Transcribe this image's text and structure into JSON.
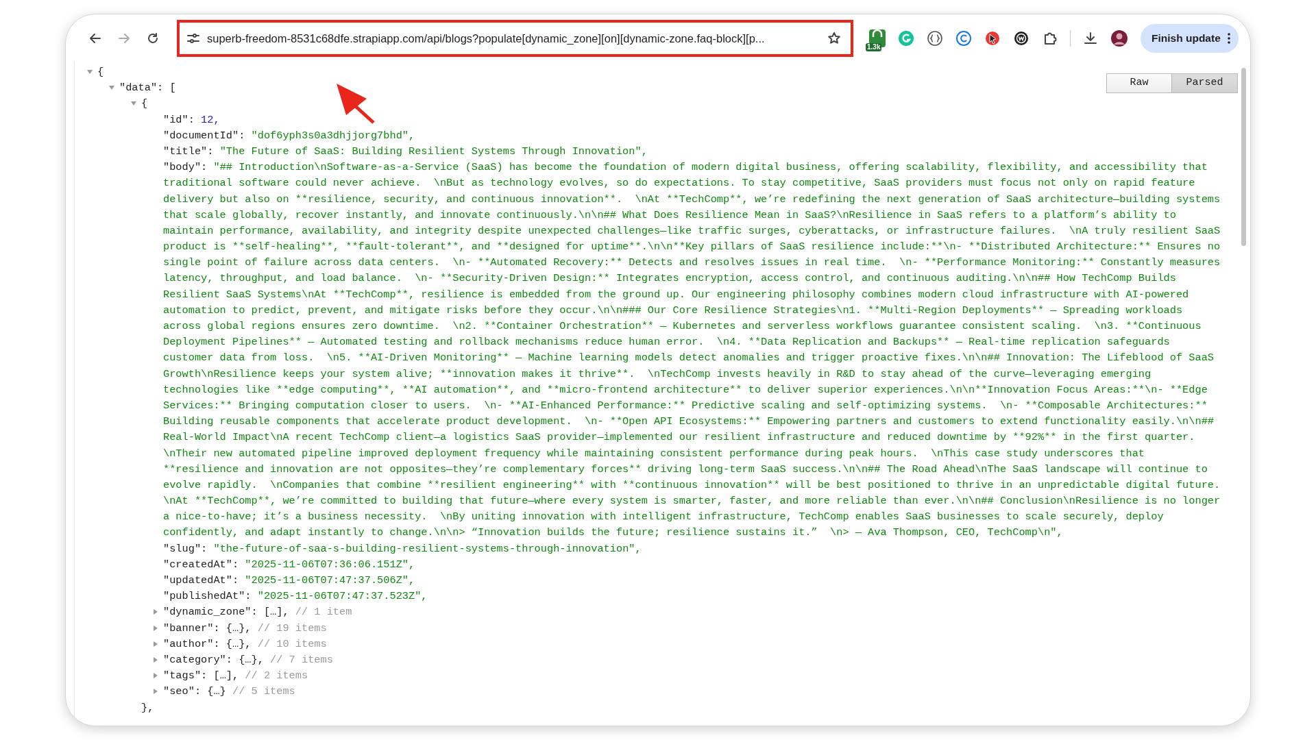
{
  "browser": {
    "url": "superb-freedom-8531c68dfe.strapiapp.com/api/blogs?populate[dynamic_zone][on][dynamic-zone.faq-block][p...",
    "extension_badge": "1.3k",
    "update_button": "Finish update"
  },
  "annotations": {
    "url_highlight": true,
    "arrow": true
  },
  "viewer_modes": [
    {
      "label": "Raw",
      "selected": false
    },
    {
      "label": "Parsed",
      "selected": true
    }
  ],
  "json_tree": {
    "open": "{",
    "expanded": true,
    "children": [
      {
        "key": "\"data\":",
        "open": "[",
        "expanded": true,
        "children": [
          {
            "open": "{",
            "expanded": true,
            "close": "},",
            "children": [
              {
                "kind": "number",
                "key": "\"id\":",
                "value": "12,"
              },
              {
                "kind": "string",
                "key": "\"documentId\":",
                "value": "\"dof6yph3s0a3dhjjorg7bhd\","
              },
              {
                "kind": "string",
                "key": "\"title\":",
                "value": "\"The Future of SaaS: Building Resilient Systems Through Innovation\","
              },
              {
                "kind": "long_string",
                "key": "\"body\":",
                "value_lines": [
                  "\"## Introduction\\nSoftware-as-a-Service (SaaS) has become the foundation of modern digital business, offering scalability, flexibility, and accessibility that",
                  "traditional software could never achieve.  \\nBut as technology evolves, so do expectations. To stay competitive, SaaS providers must focus not only on rapid feature",
                  "delivery but also on **resilience, security, and continuous innovation**.  \\nAt **TechComp**, we’re redefining the next generation of SaaS architecture—building systems",
                  "that scale globally, recover instantly, and innovate continuously.\\n\\n## What Does Resilience Mean in SaaS?\\nResilience in SaaS refers to a platform’s ability to",
                  "maintain performance, availability, and integrity despite unexpected challenges—like traffic surges, cyberattacks, or infrastructure failures.  \\nA truly resilient SaaS",
                  "product is **self-healing**, **fault-tolerant**, and **designed for uptime**.\\n\\n**Key pillars of SaaS resilience include:**\\n- **Distributed Architecture:** Ensures no",
                  "single point of failure across data centers.  \\n- **Automated Recovery:** Detects and resolves issues in real time.  \\n- **Performance Monitoring:** Constantly measures",
                  "latency, throughput, and load balance.  \\n- **Security-Driven Design:** Integrates encryption, access control, and continuous auditing.\\n\\n## How TechComp Builds",
                  "Resilient SaaS Systems\\nAt **TechComp**, resilience is embedded from the ground up. Our engineering philosophy combines modern cloud infrastructure with AI-powered",
                  "automation to predict, prevent, and mitigate risks before they occur.\\n\\n### Our Core Resilience Strategies\\n1. **Multi-Region Deployments** — Spreading workloads",
                  "across global regions ensures zero downtime.  \\n2. **Container Orchestration** — Kubernetes and serverless workflows guarantee consistent scaling.  \\n3. **Continuous",
                  "Deployment Pipelines** — Automated testing and rollback mechanisms reduce human error.  \\n4. **Data Replication and Backups** — Real-time replication safeguards",
                  "customer data from loss.  \\n5. **AI-Driven Monitoring** — Machine learning models detect anomalies and trigger proactive fixes.\\n\\n## Innovation: The Lifeblood of SaaS",
                  "Growth\\nResilience keeps your system alive; **innovation makes it thrive**.  \\nTechComp invests heavily in R&D to stay ahead of the curve—leveraging emerging",
                  "technologies like **edge computing**, **AI automation**, and **micro-frontend architecture** to deliver superior experiences.\\n\\n**Innovation Focus Areas:**\\n- **Edge",
                  "Services:** Bringing computation closer to users.  \\n- **AI-Enhanced Performance:** Predictive scaling and self-optimizing systems.  \\n- **Composable Architectures:**",
                  "Building reusable components that accelerate product development.  \\n- **Open API Ecosystems:** Empowering partners and customers to extend functionality easily.\\n\\n##",
                  "Real-World Impact\\nA recent TechComp client—a logistics SaaS provider—implemented our resilient infrastructure and reduced downtime by **92%** in the first quarter.",
                  "\\nTheir new automated pipeline improved deployment frequency while maintaining consistent performance during peak hours.  \\nThis case study underscores that",
                  "**resilience and innovation are not opposites—they’re complementary forces** driving long-term SaaS success.\\n\\n## The Road Ahead\\nThe SaaS landscape will continue to",
                  "evolve rapidly.  \\nCompanies that combine **resilient engineering** with **continuous innovation** will be best positioned to thrive in an unpredictable digital future.",
                  "\\nAt **TechComp**, we’re committed to building that future—where every system is smarter, faster, and more reliable than ever.\\n\\n## Conclusion\\nResilience is no longer",
                  "a nice-to-have; it’s a business necessity.  \\nBy uniting innovation with intelligent infrastructure, TechComp enables SaaS businesses to scale securely, deploy",
                  "confidently, and adapt instantly to change.\\n\\n> “Innovation builds the future; resilience sustains it.”  \\n> — Ava Thompson, CEO, TechComp\\n\","
                ]
              },
              {
                "kind": "string",
                "key": "\"slug\":",
                "value": "\"the-future-of-saa-s-building-resilient-systems-through-innovation\","
              },
              {
                "kind": "string",
                "key": "\"createdAt\":",
                "value": "\"2025-11-06T07:36:06.151Z\","
              },
              {
                "kind": "string",
                "key": "\"updatedAt\":",
                "value": "\"2025-11-06T07:47:37.506Z\","
              },
              {
                "kind": "string",
                "key": "\"publishedAt\":",
                "value": "\"2025-11-06T07:47:37.523Z\","
              },
              {
                "kind": "collapsed",
                "expanded": false,
                "key": "\"dynamic_zone\":",
                "value": "[…],",
                "comment": "// 1 item"
              },
              {
                "kind": "collapsed",
                "expanded": false,
                "key": "\"banner\":",
                "value": "{…},",
                "comment": "// 19 items"
              },
              {
                "kind": "collapsed",
                "expanded": false,
                "key": "\"author\":",
                "value": "{…},",
                "comment": "// 10 items"
              },
              {
                "kind": "collapsed",
                "expanded": false,
                "key": "\"category\":",
                "value": "{…},",
                "comment": "// 7 items"
              },
              {
                "kind": "collapsed",
                "expanded": false,
                "key": "\"tags\":",
                "value": "[…],",
                "comment": "// 2 items"
              },
              {
                "kind": "collapsed",
                "expanded": false,
                "key": "\"seo\":",
                "value": "{…}",
                "comment": "// 5 items"
              }
            ]
          }
        ]
      }
    ]
  }
}
